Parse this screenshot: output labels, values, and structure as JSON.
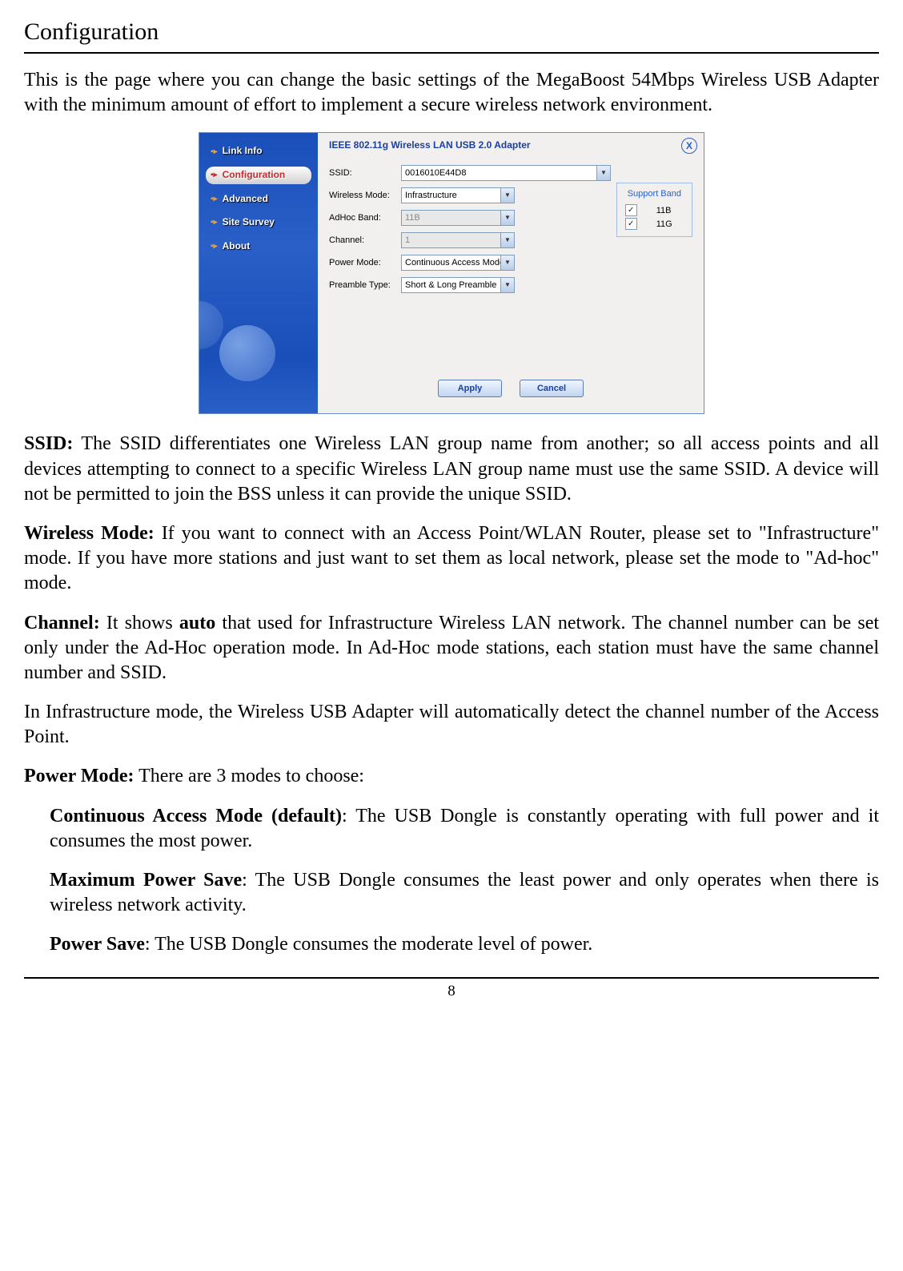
{
  "page": {
    "title": "Configuration",
    "intro": "This is the page where you can change the basic settings of the MegaBoost 54Mbps Wireless USB Adapter with the minimum amount of effort to implement a secure wireless network environment.",
    "page_number": "8"
  },
  "app": {
    "adapter_title": "IEEE 802.11g Wireless LAN USB 2.0 Adapter",
    "close_x": "X",
    "nav": {
      "link_info": "Link Info",
      "configuration": "Configuration",
      "advanced": "Advanced",
      "site_survey": "Site Survey",
      "about": "About"
    },
    "labels": {
      "ssid": "SSID:",
      "wireless_mode": "Wireless Mode:",
      "adhoc_band": "AdHoc Band:",
      "channel": "Channel:",
      "power_mode": "Power Mode:",
      "preamble_type": "Preamble Type:"
    },
    "values": {
      "ssid": "0016010E44D8",
      "wireless_mode": "Infrastructure",
      "adhoc_band": "11B",
      "channel": "1",
      "power_mode": "Continuous Access Mode",
      "preamble_type": "Short & Long Preamble"
    },
    "support_band_legend": "Support Band",
    "cb_11b": "11B",
    "cb_11g": "11G",
    "check_mark": "✓",
    "btn_apply": "Apply",
    "btn_cancel": "Cancel",
    "dd_arrow": "▼"
  },
  "body_text": {
    "ssid_label": "SSID:",
    "ssid_body": " The SSID differentiates one Wireless LAN group name from another; so all access points and all devices attempting to connect to a specific Wireless LAN group name must use the same SSID. A device will not be permitted to join the BSS unless it can provide the unique SSID.",
    "wm_label": "Wireless Mode:",
    "wm_body": " If you want to connect with an Access Point/WLAN Router, please set to \"Infrastructure\" mode. If you have more stations and just want to set them as local network, please set the mode to \"Ad-hoc\" mode.",
    "ch_label": "Channel:",
    "ch_body_a": " It shows ",
    "ch_bold_auto": "auto",
    "ch_body_b": " that used for Infrastructure Wireless LAN network. The channel number can be set only under the Ad-Hoc operation mode. In Ad-Hoc mode stations, each station must have the same channel number and SSID.",
    "ch_para2": "In Infrastructure mode, the Wireless USB Adapter will automatically detect the channel number of the Access Point.",
    "pm_label": "Power Mode:",
    "pm_body": " There are 3 modes to choose:",
    "cam_label": "Continuous Access Mode (default)",
    "cam_body": ": The USB Dongle is constantly operating with full power and it consumes the most power.",
    "mps_label": "Maximum Power Save",
    "mps_body": ": The USB Dongle consumes the least power and only operates when there is wireless network activity.",
    "ps_label": "Power Save",
    "ps_body": ": The USB Dongle consumes the moderate level of power."
  }
}
